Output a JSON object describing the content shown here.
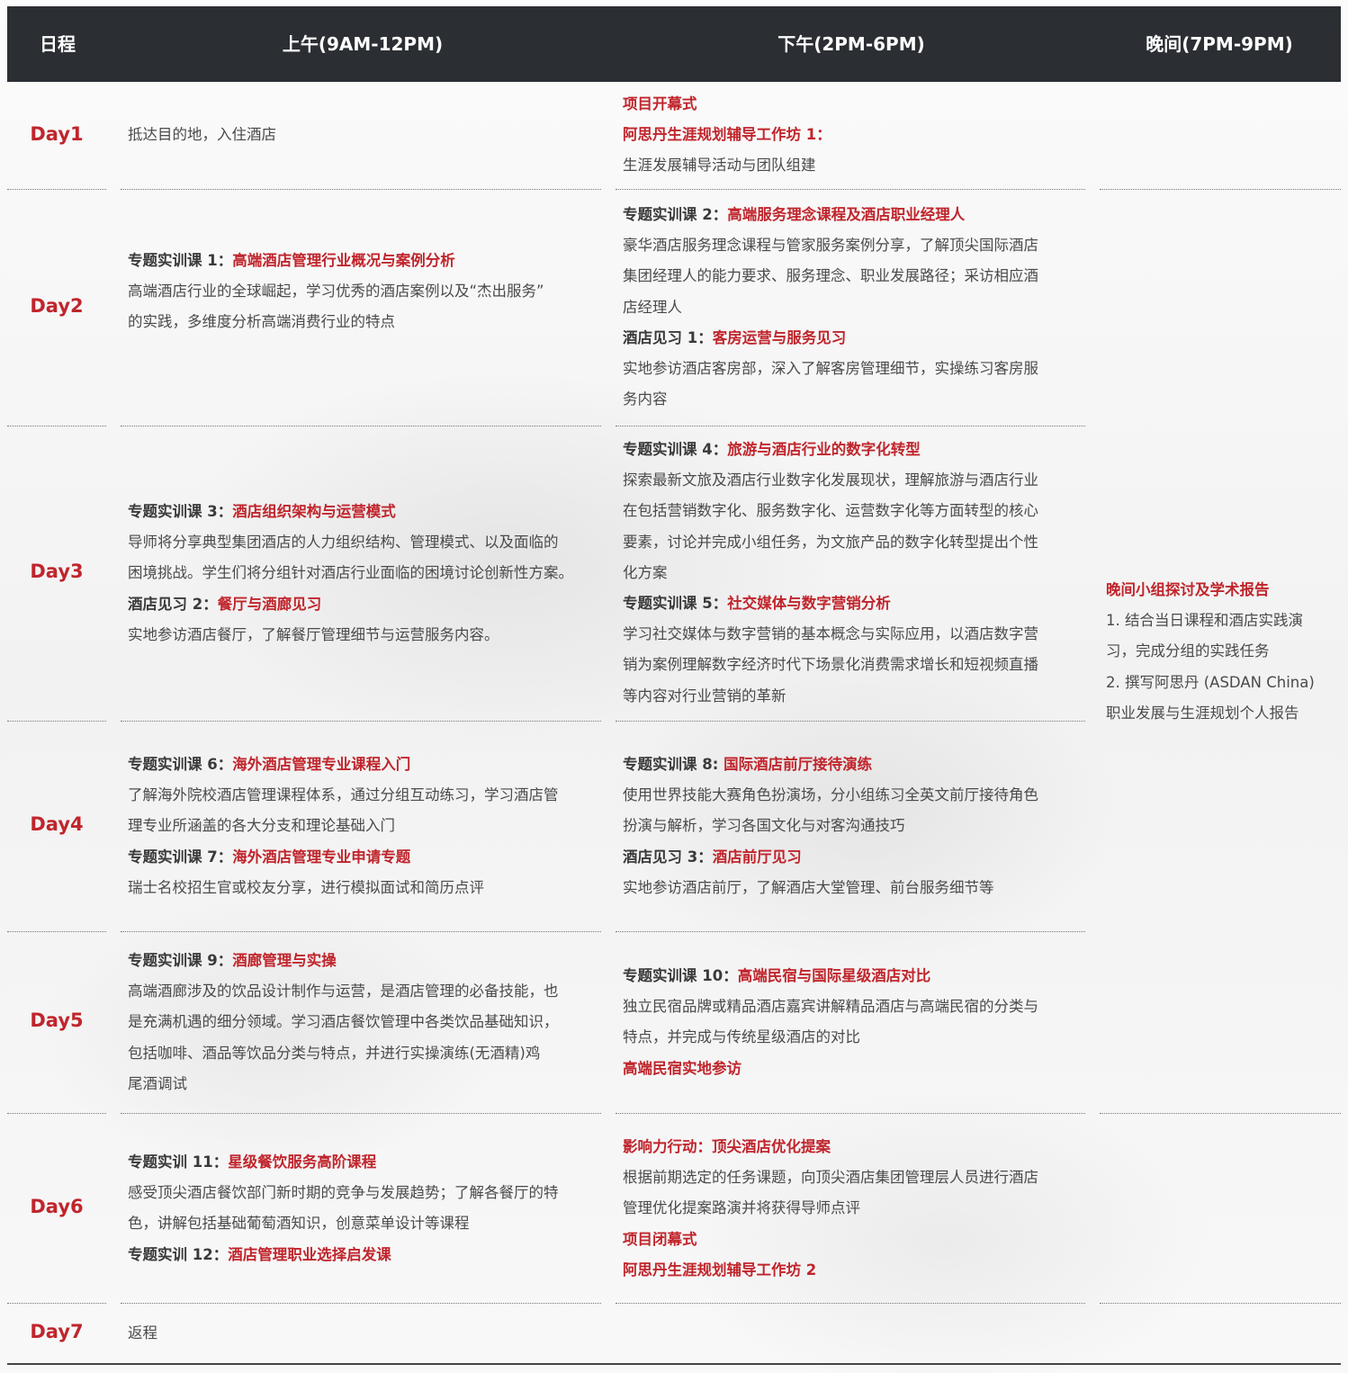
{
  "header": {
    "col_day": "日程",
    "col_morning": "上午(9AM-12PM)",
    "col_afternoon": "下午(2PM-6PM)",
    "col_evening": "晚间(7PM-9PM)"
  },
  "days": {
    "d1": {
      "label": "Day1",
      "am_text": "抵达目的地，入住酒店",
      "pm_line1": "项目开幕式",
      "pm_line2": "阿思丹生涯规划辅导工作坊 1：",
      "pm_line3": "生涯发展辅导活动与团队组建"
    },
    "d2": {
      "label": "Day2",
      "am_prefix": "专题实训课 1：",
      "am_title": "高端酒店管理行业概况与案例分析",
      "am_desc1": "高端酒店行业的全球崛起，学习优秀的酒店案例以及“杰出服务”",
      "am_desc2": "的实践，多维度分析高端消费行业的特点",
      "pm_prefix": "专题实训课 2：",
      "pm_title": "高端服务理念课程及酒店职业经理人",
      "pm_desc1": "豪华酒店服务理念课程与管家服务案例分享，了解顶尖国际酒店",
      "pm_desc2": "集团经理人的能力要求、服务理念、职业发展路径；采访相应酒",
      "pm_desc3": "店经理人",
      "pm_prefix2": "酒店见习 1：",
      "pm_title2": "客房运营与服务见习",
      "pm_desc4": "实地参访酒店客房部，深入了解客房管理细节，实操练习客房服",
      "pm_desc5": "务内容"
    },
    "d3": {
      "label": "Day3",
      "am_prefix": "专题实训课 3：",
      "am_title": "酒店组织架构与运营模式",
      "am_desc1": "导师将分享典型集团酒店的人力组织结构、管理模式、以及面临的",
      "am_desc2": "困境挑战。学生们将分组针对酒店行业面临的困境讨论创新性方案。",
      "am_prefix2": "酒店见习 2：",
      "am_title2": "餐厅与酒廊见习",
      "am_desc3": "实地参访酒店餐厅，了解餐厅管理细节与运营服务内容。",
      "pm_prefix": "专题实训课 4：",
      "pm_title": "旅游与酒店行业的数字化转型",
      "pm_desc1": "探索最新文旅及酒店行业数字化发展现状，理解旅游与酒店行业",
      "pm_desc2": "在包括营销数字化、服务数字化、运营数字化等方面转型的核心",
      "pm_desc3": "要素，讨论并完成小组任务，为文旅产品的数字化转型提出个性",
      "pm_desc4": "化方案",
      "pm_prefix2": "专题实训课 5：",
      "pm_title2": "社交媒体与数字营销分析",
      "pm_desc5": "学习社交媒体与数字营销的基本概念与实际应用，以酒店数字营",
      "pm_desc6": "销为案例理解数字经济时代下场景化消费需求增长和短视频直播",
      "pm_desc7": "等内容对行业营销的革新"
    },
    "d4": {
      "label": "Day4",
      "am_prefix": "专题实训课 6：",
      "am_title": "海外酒店管理专业课程入门",
      "am_desc1": "了解海外院校酒店管理课程体系，通过分组互动练习，学习酒店管",
      "am_desc2": "理专业所涵盖的各大分支和理论基础入门",
      "am_prefix2": "专题实训课 7：",
      "am_title2": "海外酒店管理专业申请专题",
      "am_desc3": "瑞士名校招生官或校友分享，进行模拟面试和简历点评",
      "pm_prefix": "专题实训课 8: ",
      "pm_title": "国际酒店前厅接待演练",
      "pm_desc1": "使用世界技能大赛角色扮演场，分小组练习全英文前厅接待角色",
      "pm_desc2": "扮演与解析，学习各国文化与对客沟通技巧",
      "pm_prefix2": "酒店见习 3：",
      "pm_title2": "酒店前厅见习",
      "pm_desc3": "实地参访酒店前厅，了解酒店大堂管理、前台服务细节等"
    },
    "d5": {
      "label": "Day5",
      "am_prefix": "专题实训课 9：",
      "am_title": "酒廊管理与实操",
      "am_desc1": "高端酒廊涉及的饮品设计制作与运营，是酒店管理的必备技能，也",
      "am_desc2": "是充满机遇的细分领域。学习酒店餐饮管理中各类饮品基础知识，",
      "am_desc3": "包括咖啡、酒品等饮品分类与特点，并进行实操演练(无酒精)鸡",
      "am_desc4": "尾酒调试",
      "pm_prefix": "专题实训课 10：",
      "pm_title": "高端民宿与国际星级酒店对比",
      "pm_desc1": "独立民宿品牌或精品酒店嘉宾讲解精品酒店与高端民宿的分类与",
      "pm_desc2": "特点，并完成与传统星级酒店的对比",
      "pm_line_red": "高端民宿实地参访"
    },
    "d6": {
      "label": "Day6",
      "am_prefix": "专题实训 11：",
      "am_title": "星级餐饮服务高阶课程",
      "am_desc1": "感受顶尖酒店餐饮部门新时期的竞争与发展趋势；了解各餐厅的特",
      "am_desc2": "色，讲解包括基础葡萄酒知识，创意菜单设计等课程",
      "am_prefix2": "专题实训 12：",
      "am_title2": "酒店管理职业选择启发课",
      "pm_line1": "影响力行动：顶尖酒店优化提案",
      "pm_desc1": "根据前期选定的任务课题，向顶尖酒店集团管理层人员进行酒店",
      "pm_desc2": "管理优化提案路演并将获得导师点评",
      "pm_line2": "项目闭幕式",
      "pm_line3": "阿思丹生涯规划辅导工作坊 2"
    },
    "d7": {
      "label": "Day7",
      "am_text": "返程"
    }
  },
  "evening": {
    "title": "晚间小组探讨及学术报告",
    "line1": "1. 结合当日课程和酒店实践演",
    "line2": "习，完成分组的实践任务",
    "line3": "2. 撰写阿思丹 (ASDAN China)",
    "line4": "职业发展与生涯规划个人报告"
  },
  "colors": {
    "header_bg": "#2b2e33",
    "accent_red": "#c0252c",
    "text": "#4a4a4a"
  }
}
